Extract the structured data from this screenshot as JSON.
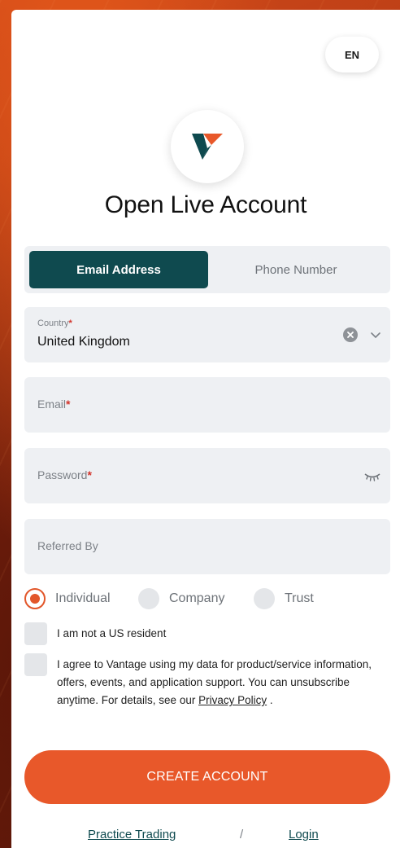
{
  "language": {
    "label": "EN"
  },
  "header": {
    "title": "Open Live Account"
  },
  "tabs": [
    {
      "label": "Email Address",
      "active": true
    },
    {
      "label": "Phone Number",
      "active": false
    }
  ],
  "form": {
    "country": {
      "label": "Country",
      "required_mark": "*",
      "value": "United Kingdom"
    },
    "email": {
      "placeholder": "Email",
      "required_mark": "*"
    },
    "password": {
      "placeholder": "Password",
      "required_mark": "*"
    },
    "referred_by": {
      "placeholder": "Referred By"
    }
  },
  "account_types": [
    {
      "label": "Individual",
      "selected": true
    },
    {
      "label": "Company",
      "selected": false
    },
    {
      "label": "Trust",
      "selected": false
    }
  ],
  "consents": {
    "us_resident": "I am not a US resident",
    "agree_text": "I agree to Vantage using my data for product/service information, offers, events, and application support. You can unsubscribe anytime. For details, see our",
    "privacy_link": "Privacy Policy",
    "agree_end": "."
  },
  "cta": {
    "label": "CREATE ACCOUNT"
  },
  "footer": {
    "practice": "Practice Trading",
    "separator": "/",
    "login": "Login"
  },
  "colors": {
    "brand_teal": "#0f4a4f",
    "accent_orange": "#e8582a",
    "required_red": "#d2332a"
  },
  "icons": {
    "logo": "vantage-v-logo",
    "clear": "clear-circle-icon",
    "dropdown": "chevron-down-icon",
    "password_toggle": "eye-closed-icon"
  }
}
